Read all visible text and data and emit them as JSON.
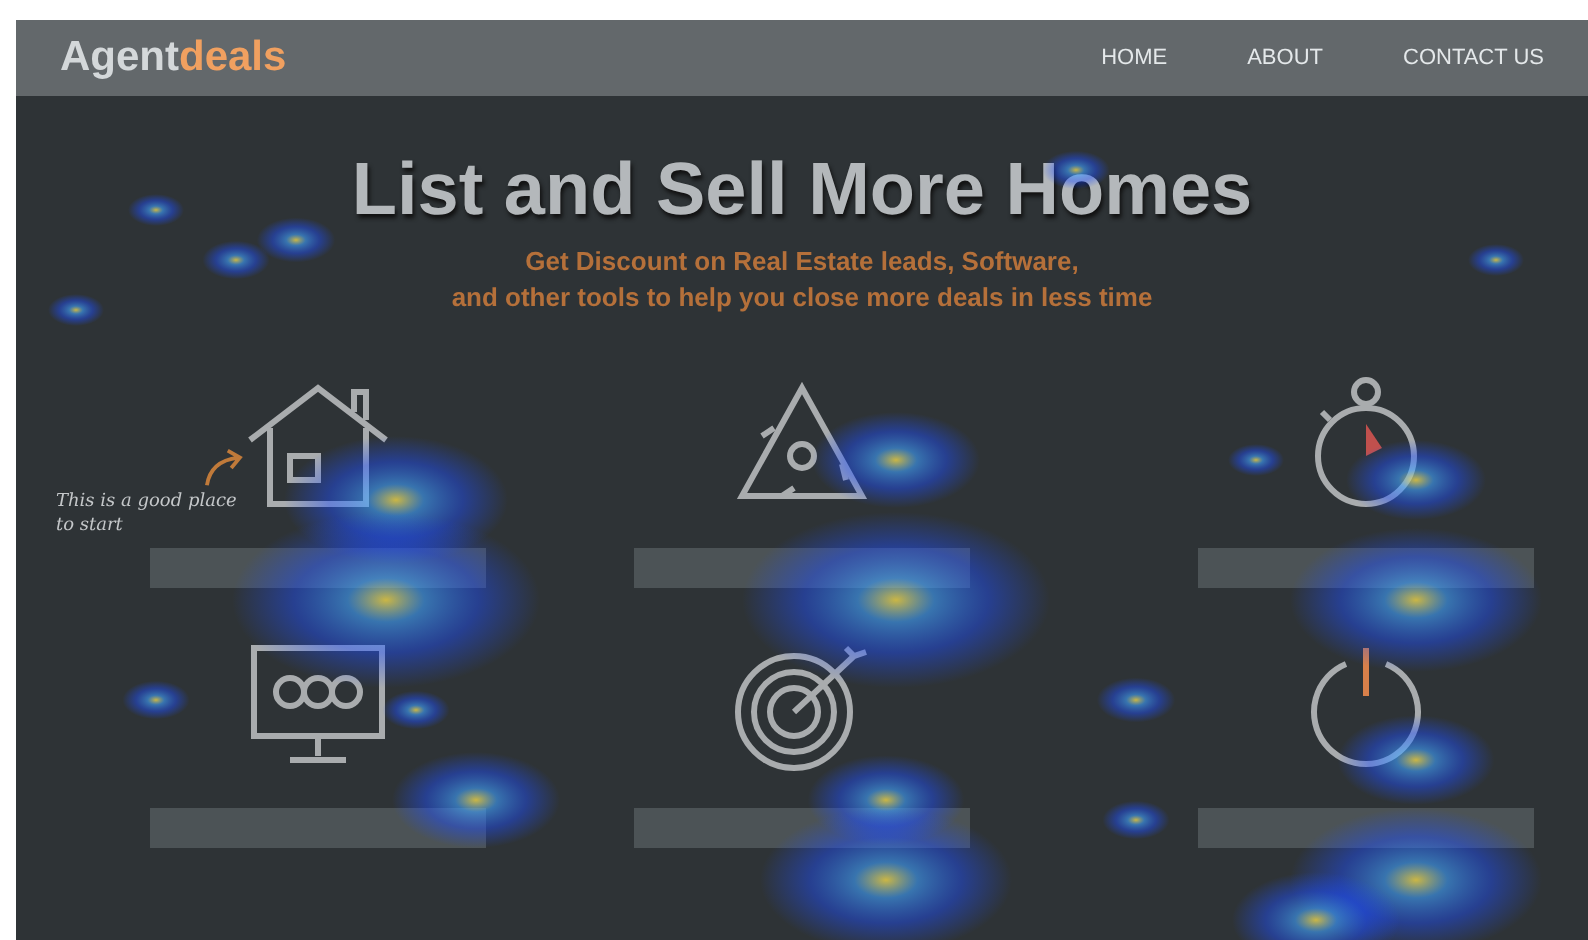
{
  "logo": {
    "prefix": "Agent",
    "suffix": "deals"
  },
  "nav": [
    "HOME",
    "ABOUT",
    "CONTACT US"
  ],
  "hero": {
    "title": "List and Sell More Homes",
    "subtitle_lines": [
      "Get Discount on Real Estate leads, Software,",
      "and other tools to help you close more deals in less time"
    ]
  },
  "note": {
    "text": "This is a good place to start"
  },
  "features": [
    {
      "kind": "house"
    },
    {
      "kind": "cycle"
    },
    {
      "kind": "stopwatch"
    },
    {
      "kind": "monitor"
    },
    {
      "kind": "target"
    },
    {
      "kind": "power"
    }
  ]
}
